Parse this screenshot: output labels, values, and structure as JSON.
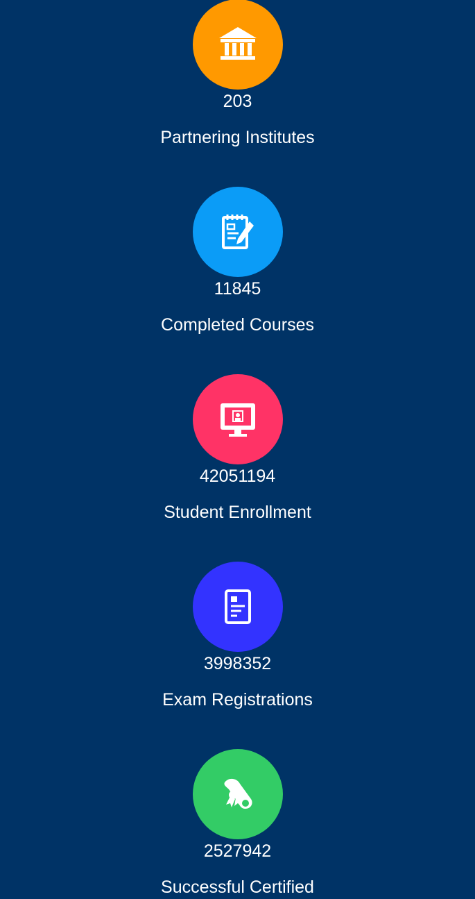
{
  "colors": {
    "background": "#003366",
    "orange": "#ff9900",
    "blue": "#0b9cf7",
    "pink": "#ff3366",
    "indigo": "#3333ff",
    "green": "#33cc66"
  },
  "stats": [
    {
      "icon": "institute-building-icon",
      "count": "203",
      "label": "Partnering Institutes"
    },
    {
      "icon": "notepad-pen-icon",
      "count": "11845",
      "label": "Completed Courses"
    },
    {
      "icon": "monitor-user-icon",
      "count": "42051194",
      "label": "Student Enrollment"
    },
    {
      "icon": "document-icon",
      "count": "3998352",
      "label": "Exam Registrations"
    },
    {
      "icon": "certificate-scroll-icon",
      "count": "2527942",
      "label": "Successful Certified"
    }
  ]
}
